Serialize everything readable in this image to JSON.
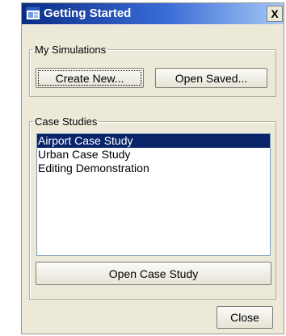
{
  "window": {
    "title": "Getting Started",
    "close_glyph": "X",
    "title_icon": "app-window-icon"
  },
  "my_simulations": {
    "legend": "My Simulations",
    "create_new_label": "Create New...",
    "open_saved_label": "Open Saved..."
  },
  "case_studies": {
    "legend": "Case Studies",
    "items": [
      {
        "label": "Airport Case Study",
        "selected": true
      },
      {
        "label": "Urban Case Study",
        "selected": false
      },
      {
        "label": "Editing Demonstration",
        "selected": false
      }
    ],
    "open_label": "Open Case Study"
  },
  "footer": {
    "close_label": "Close"
  },
  "colors": {
    "titlebar_start": "#0a2d86",
    "titlebar_end": "#a6c8f6",
    "selection": "#0a246a",
    "dialog_bg": "#ece9d8"
  }
}
